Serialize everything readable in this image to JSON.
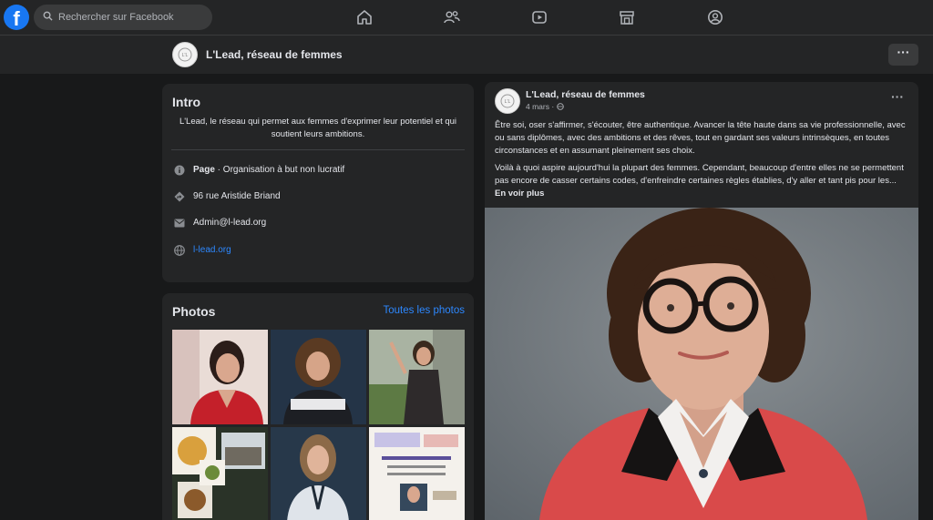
{
  "topnav": {
    "logo": "f",
    "search_placeholder": "Rechercher sur Facebook",
    "icons": [
      "home-icon",
      "friends-icon",
      "watch-icon",
      "marketplace-icon",
      "groups-icon"
    ]
  },
  "pagebar": {
    "name": "L'Lead, réseau de femmes",
    "more": "···"
  },
  "intro": {
    "title": "Intro",
    "description": "L'Lead, le réseau qui permet aux femmes d'exprimer leur potentiel et qui soutient leurs ambitions.",
    "category_label": "Page",
    "category_value": " · Organisation à but non lucratif",
    "address": "96 rue Aristide Briand",
    "email": "Admin@l-lead.org",
    "website": "l-lead.org"
  },
  "photos": {
    "title": "Photos",
    "see_all": "Toutes les photos"
  },
  "post": {
    "author": "L'Lead, réseau de femmes",
    "date": "4 mars · ",
    "more": "···",
    "paragraph1": "Être soi, oser s'affirmer, s'écouter, être authentique. Avancer la tête haute dans sa vie professionnelle, avec ou sans diplômes, avec des ambitions et des rêves, tout en gardant ses valeurs intrinsèques, en toutes circonstances et en assumant pleinement ses choix.",
    "paragraph2": "Voilà à quoi aspire aujourd'hui la plupart des femmes. Cependant, beaucoup d'entre elles ne se permettent pas encore de casser certains codes, d'enfreindre certaines règles établies, d'y aller et tant pis pour les... ",
    "see_more": "En voir plus"
  },
  "colors": {
    "background": "#18191a",
    "surface": "#242526",
    "accent": "#2d88ff",
    "brand": "#1877f2"
  }
}
